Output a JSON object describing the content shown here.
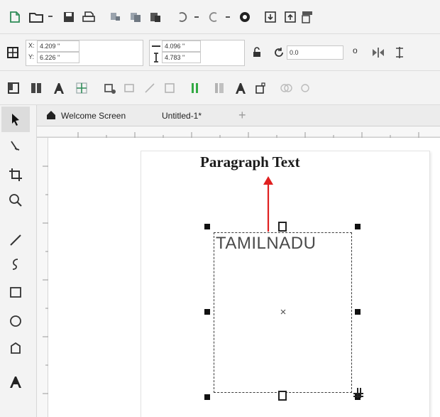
{
  "toolbar": {
    "icons": [
      "new-document-icon",
      "open-folder-icon",
      "save-icon",
      "print-icon",
      "cut-icon",
      "copy-icon",
      "paste-icon",
      "undo-icon",
      "redo-icon",
      "search-content-icon",
      "import-icon",
      "export-icon",
      "publish-pdf-icon"
    ]
  },
  "property_bar": {
    "x_label": "X:",
    "x_value": "4.209 \"",
    "y_label": "Y:",
    "y_value": "6.226 \"",
    "width_value": "4.096 \"",
    "height_value": "4.783 \"",
    "rotation_value": "0.0",
    "degree_symbol": "o"
  },
  "tabs": {
    "welcome": "Welcome Screen",
    "untitled": "Untitled-1*",
    "add": "+"
  },
  "canvas": {
    "annotation": "Paragraph Text",
    "paragraph_text": "TAMILNADU",
    "arrow_color": "#e02020"
  }
}
